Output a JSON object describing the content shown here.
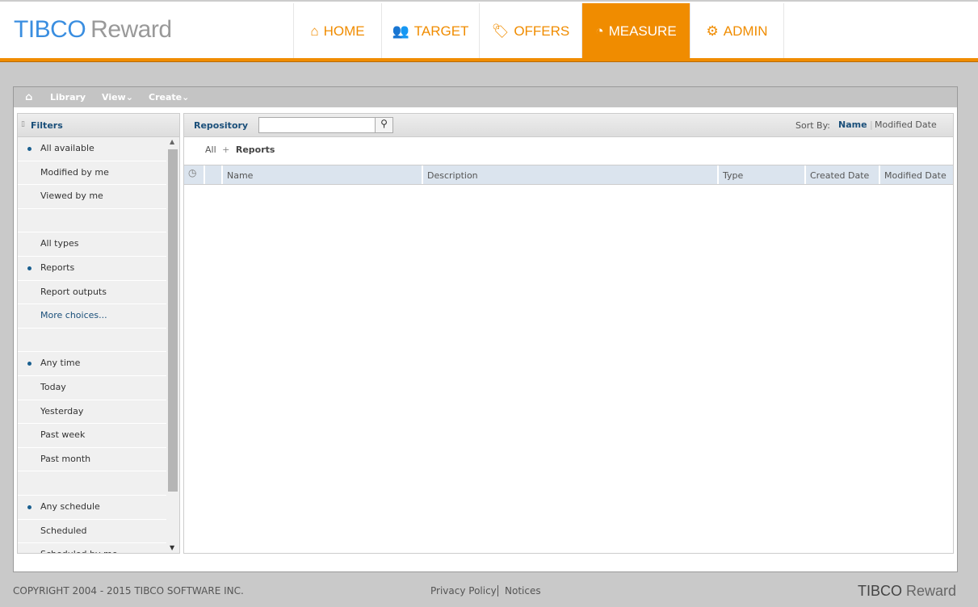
{
  "header": {
    "logo_brand": "TIBCO",
    "logo_product": "Reward",
    "nav": [
      {
        "label": "HOME",
        "icon": "home-icon"
      },
      {
        "label": "TARGET",
        "icon": "users-icon"
      },
      {
        "label": "OFFERS",
        "icon": "tags-icon"
      },
      {
        "label": "MEASURE",
        "icon": "dashboard-icon",
        "active": true
      },
      {
        "label": "ADMIN",
        "icon": "cogs-icon"
      }
    ]
  },
  "toolbar": {
    "library": "Library",
    "view": "View",
    "create": "Create"
  },
  "filters": {
    "title": "Filters",
    "items": [
      "All available",
      "Modified by me",
      "Viewed by me",
      "",
      "All types",
      "Reports",
      "Report outputs",
      "More choices...",
      "",
      "Any time",
      "Today",
      "Yesterday",
      "Past week",
      "Past month",
      "",
      "Any schedule",
      "Scheduled",
      "Scheduled by me"
    ],
    "selected": [
      "All available",
      "Reports",
      "Any time",
      "Any schedule"
    ]
  },
  "repository": {
    "title": "Repository",
    "search_value": "",
    "sort_label": "Sort By:",
    "sort_name": "Name",
    "sort_modified": "Modified Date",
    "breadcrumb_all": "All",
    "breadcrumb_sep": "+",
    "breadcrumb_current": "Reports",
    "columns": [
      "Name",
      "Description",
      "Type",
      "Created Date",
      "Modified Date"
    ]
  },
  "footer": {
    "copyright": "COPYRIGHT 2004 - 2015 TIBCO SOFTWARE INC.",
    "privacy": "Privacy Policy",
    "notices": "Notices",
    "logo_brand": "TIBCO",
    "logo_product": "Reward"
  },
  "colors": {
    "accent": "#f08c00",
    "brand_blue": "#3a8ee0",
    "link": "#1a4f7a"
  }
}
